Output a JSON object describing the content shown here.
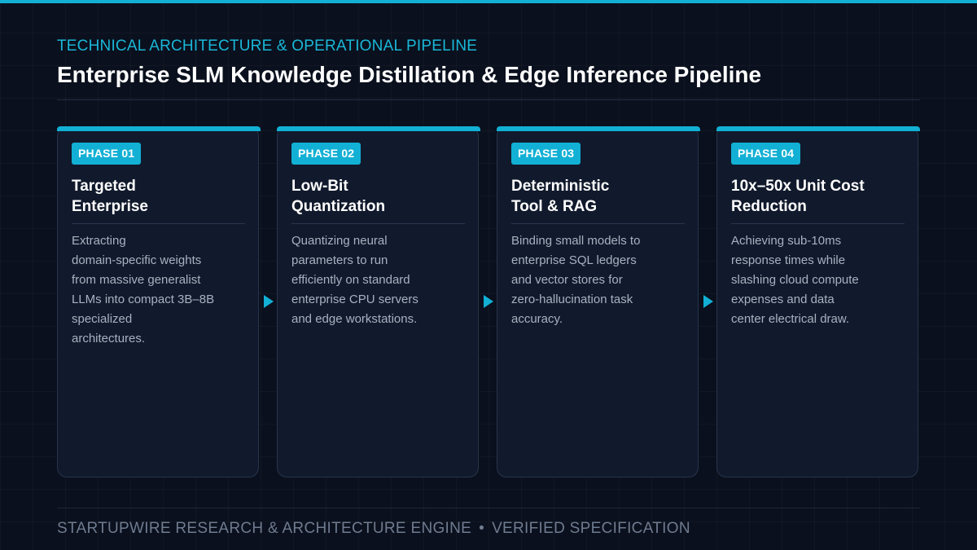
{
  "header": {
    "kicker": "TECHNICAL ARCHITECTURE & OPERATIONAL PIPELINE",
    "title": "Enterprise SLM Knowledge Distillation & Edge Inference Pipeline"
  },
  "colors": {
    "accent": "#12b0d4",
    "background": "#0a101d",
    "card": "#111a2c",
    "title_text": "#ffffff",
    "body_text": "#a8b1c0",
    "footer_text": "#6f7b8f"
  },
  "phases": [
    {
      "badge": "PHASE 01",
      "title": "Targeted\nEnterprise",
      "description": "Extracting\ndomain-specific weights\nfrom massive generalist\nLLMs into compact 3B–8B\nspecialized\narchitectures."
    },
    {
      "badge": "PHASE 02",
      "title": "Low-Bit\nQuantization",
      "description": "Quantizing neural\nparameters to run\nefficiently on standard\nenterprise CPU servers\nand edge workstations."
    },
    {
      "badge": "PHASE 03",
      "title": "Deterministic\nTool & RAG",
      "description": "Binding small models to\nenterprise SQL ledgers\nand vector stores for\nzero-hallucination task\naccuracy."
    },
    {
      "badge": "PHASE 04",
      "title": "10x–50x Unit Cost\nReduction",
      "description": "Achieving sub-10ms\nresponse times while\nslashing cloud compute\nexpenses and data\ncenter electrical draw."
    }
  ],
  "connector_icon": "arrow-right-icon",
  "footer": {
    "source": "STARTUPWIRE RESEARCH & ARCHITECTURE ENGINE",
    "separator": "•",
    "status": "VERIFIED SPECIFICATION"
  }
}
